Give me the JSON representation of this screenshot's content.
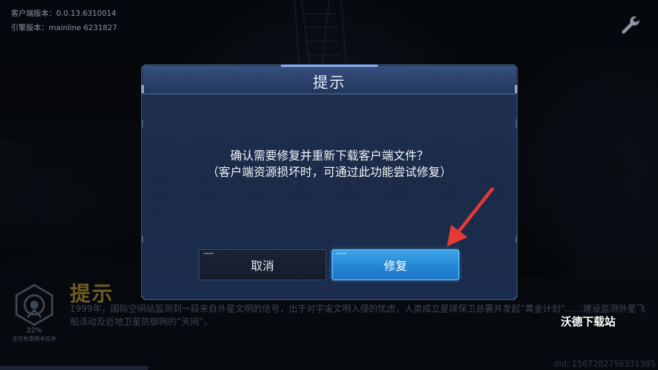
{
  "header": {
    "client_version": "客户端版本：0.0.13.6310014",
    "engine_version": "引擎版本：mainline 6231827"
  },
  "icons": {
    "settings": "wrench-icon",
    "emblem": "loading-emblem-icon",
    "annotation": "red-arrow-icon"
  },
  "loading": {
    "percent": "22%",
    "status": "正在检查版本信息"
  },
  "tip": {
    "title": "提示",
    "text": "1999年，国际空间站监测到一段来自外星文明的信号，出于对宇宙文明入侵的忧虑，人类成立星球保卫总署并发起“黄金计划”……建设监测外星飞船活动及近地卫星防御网的“天网”。"
  },
  "dialog": {
    "title": "提示",
    "message_line1": "确认需要修复并重新下载客户端文件？",
    "message_line2": "（客户端资源损坏时，可通过此功能尝试修复）",
    "cancel_label": "取消",
    "repair_label": "修复"
  },
  "watermark": "沃德下载站",
  "device_id": "did: 1567282756331395",
  "colors": {
    "dialog_bg": "#1b2b4a",
    "dialog_border": "#5f7fb0",
    "repair_button": "#2a8fdc",
    "cancel_button": "#172033",
    "arrow": "#e53935",
    "tip_title": "#6f5a22"
  }
}
